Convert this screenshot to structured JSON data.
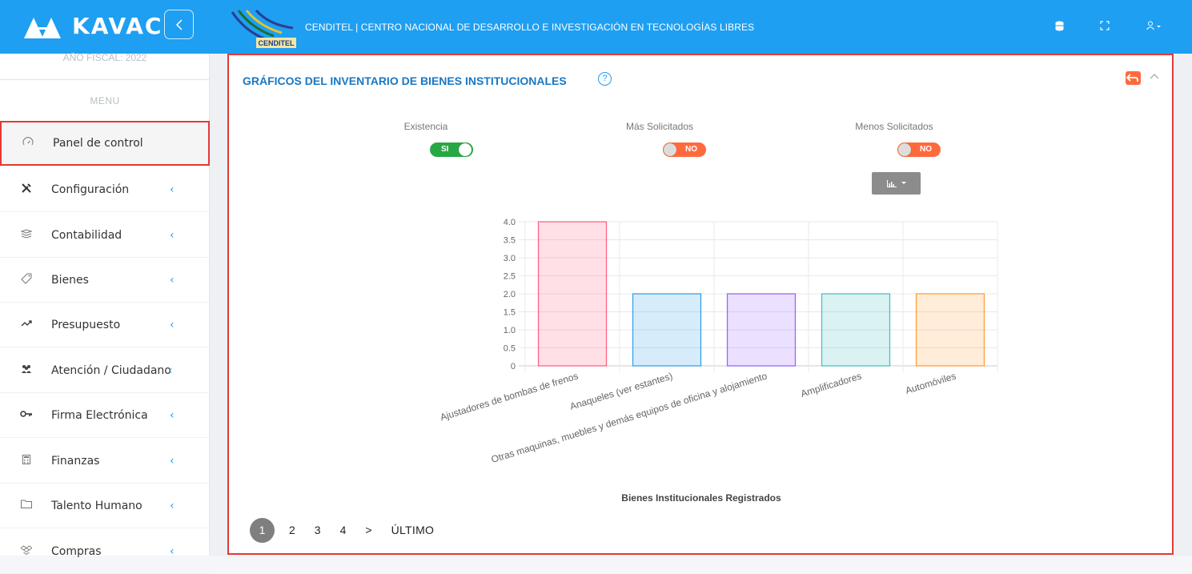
{
  "app": {
    "brand_name": "KAVAC",
    "org_title": "CENDITEL | CENTRO NACIONAL DE DESARROLLO E INVESTIGACIÓN EN TECNOLOGÍAS LIBRES",
    "org_logo_text": "CENDITEL",
    "accent_color": "#1e9ff2"
  },
  "sidebar": {
    "fiscal_year": "AÑO FISCAL: 2022",
    "menu_caption": "MENU",
    "items": [
      {
        "label": "Panel de control",
        "icon": "dashboard-gauge-icon",
        "active": true
      },
      {
        "label": "Configuración",
        "icon": "tools-icon"
      },
      {
        "label": "Contabilidad",
        "icon": "layers-icon"
      },
      {
        "label": "Bienes",
        "icon": "tag-icon"
      },
      {
        "label": "Presupuesto",
        "icon": "trend-icon"
      },
      {
        "label": "Atención / Ciudadano",
        "icon": "users-icon"
      },
      {
        "label": "Firma Electrónica",
        "icon": "key-icon"
      },
      {
        "label": "Finanzas",
        "icon": "calculator-icon"
      },
      {
        "label": "Talento Humano",
        "icon": "folder-icon"
      },
      {
        "label": "Compras",
        "icon": "dropbox-icon"
      }
    ]
  },
  "panel": {
    "title": "GRÁFICOS DEL INVENTARIO DE BIENES INSTITUCIONALES",
    "help": "?",
    "toggles": [
      {
        "label": "Existencia",
        "state": "SI"
      },
      {
        "label": "Más Solicitados",
        "state": "NO"
      },
      {
        "label": "Menos Solicitados",
        "state": "NO"
      }
    ]
  },
  "chart_data": {
    "type": "bar",
    "categories": [
      "Ajustadores de bombas de frenos",
      "Anaqueles (ver estantes)",
      "Otras maquinas, muebles y demás equipos de oficina y alojamiento",
      "Amplificadores",
      "Automóviles"
    ],
    "values": [
      4,
      2,
      2,
      2,
      2
    ],
    "colors": [
      "#ff6384",
      "#36a2eb",
      "#9966ff",
      "#4bc0c0",
      "#ff9f40"
    ],
    "xlabel": "Bienes Institucionales Registrados",
    "ylabel": "",
    "ylim": [
      0,
      4
    ],
    "yticks": [
      "4.0",
      "3.5",
      "3.0",
      "2.5",
      "2.0",
      "1.5",
      "1.0",
      "0.5",
      "0"
    ],
    "grid": true
  },
  "pagination": {
    "pages": [
      "1",
      "2",
      "3",
      "4"
    ],
    "current": "1",
    "next": ">",
    "last": "ÚLTIMO"
  }
}
